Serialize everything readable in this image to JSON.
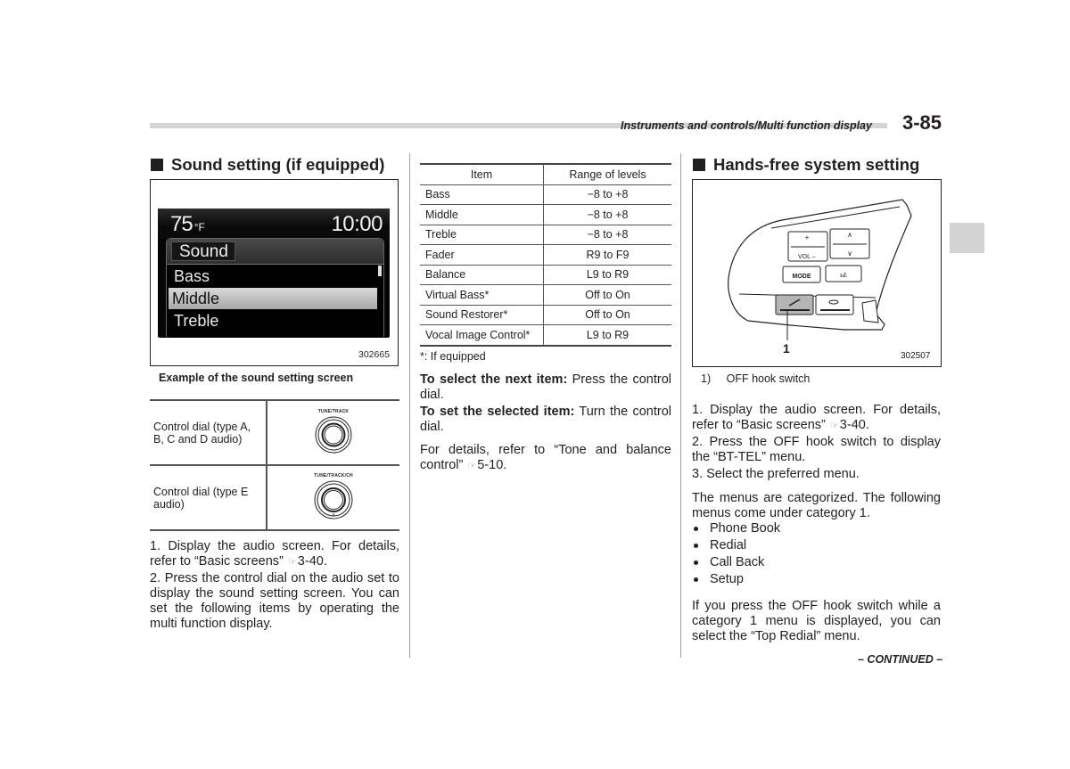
{
  "header": {
    "section_title": "Instruments and controls/Multi function display",
    "page_number": "3-85"
  },
  "left_column": {
    "heading": "Sound setting (if equipped)",
    "figure": {
      "screen": {
        "temperature": "75",
        "temperature_unit": "°F",
        "clock": "10:00",
        "menu_title": "Sound",
        "items": [
          {
            "label": "Bass",
            "selected": false
          },
          {
            "label": "Middle",
            "selected": true
          },
          {
            "label": "Treble",
            "selected": false
          }
        ]
      },
      "code": "302665",
      "caption": "Example of the sound setting screen"
    },
    "dial_table": [
      {
        "label": "Control dial (type A, B, C and D audio)",
        "dial_label": "TUNE/TRACK"
      },
      {
        "label": "Control dial (type E audio)",
        "dial_label": "TUNE/TRACK/CH"
      }
    ],
    "steps": [
      {
        "text": "1.  Display the audio screen. For details, refer to “Basic screens”",
        "ref": "3-40."
      },
      {
        "text": "2.  Press the control dial on the audio set to display the sound setting screen. You can set the following items by operating the multi function display.",
        "ref": ""
      }
    ]
  },
  "middle_column": {
    "table": {
      "headers": [
        "Item",
        "Range of levels"
      ],
      "rows": [
        [
          "Bass",
          "−8 to +8"
        ],
        [
          "Middle",
          "−8 to +8"
        ],
        [
          "Treble",
          "−8 to +8"
        ],
        [
          "Fader",
          "R9 to F9"
        ],
        [
          "Balance",
          "L9 to R9"
        ],
        [
          "Virtual Bass*",
          "Off to On"
        ],
        [
          "Sound Restorer*",
          "Off to On"
        ],
        [
          "Vocal Image Control*",
          "L9 to R9"
        ]
      ]
    },
    "footnote": "*: If equipped",
    "instructions": [
      {
        "bold": "To select the next item:",
        "text": " Press the control dial."
      },
      {
        "bold": "To set the selected item:",
        "text": " Turn the control dial."
      }
    ],
    "details": {
      "text": "For details, refer to “Tone and balance control”",
      "ref": "5-10."
    }
  },
  "right_column": {
    "heading": "Hands-free system setting",
    "figure": {
      "buttons": {
        "vol_plus": "+",
        "vol_label": "VOL –",
        "up": "∧",
        "down": "∨",
        "mode": "MODE"
      },
      "callout_number": "1",
      "code": "302507"
    },
    "legend": {
      "number": "1)",
      "text": "OFF hook switch"
    },
    "steps": [
      {
        "text": "1.  Display the audio screen. For details, refer to “Basic screens”",
        "ref": "3-40."
      },
      {
        "text": "2.  Press the OFF hook switch to display the “BT-TEL” menu.",
        "ref": ""
      },
      {
        "text": "3.  Select the preferred menu.",
        "ref": ""
      }
    ],
    "category_intro": "The menus are categorized. The following menus come under category 1.",
    "category_items": [
      "Phone Book",
      "Redial",
      "Call Back",
      "Setup"
    ],
    "closing": "If you press the OFF hook switch while a category 1 menu is displayed, you can select the “Top Redial” menu.",
    "continued": "– CONTINUED –"
  },
  "icons": {
    "reference": "☞"
  }
}
